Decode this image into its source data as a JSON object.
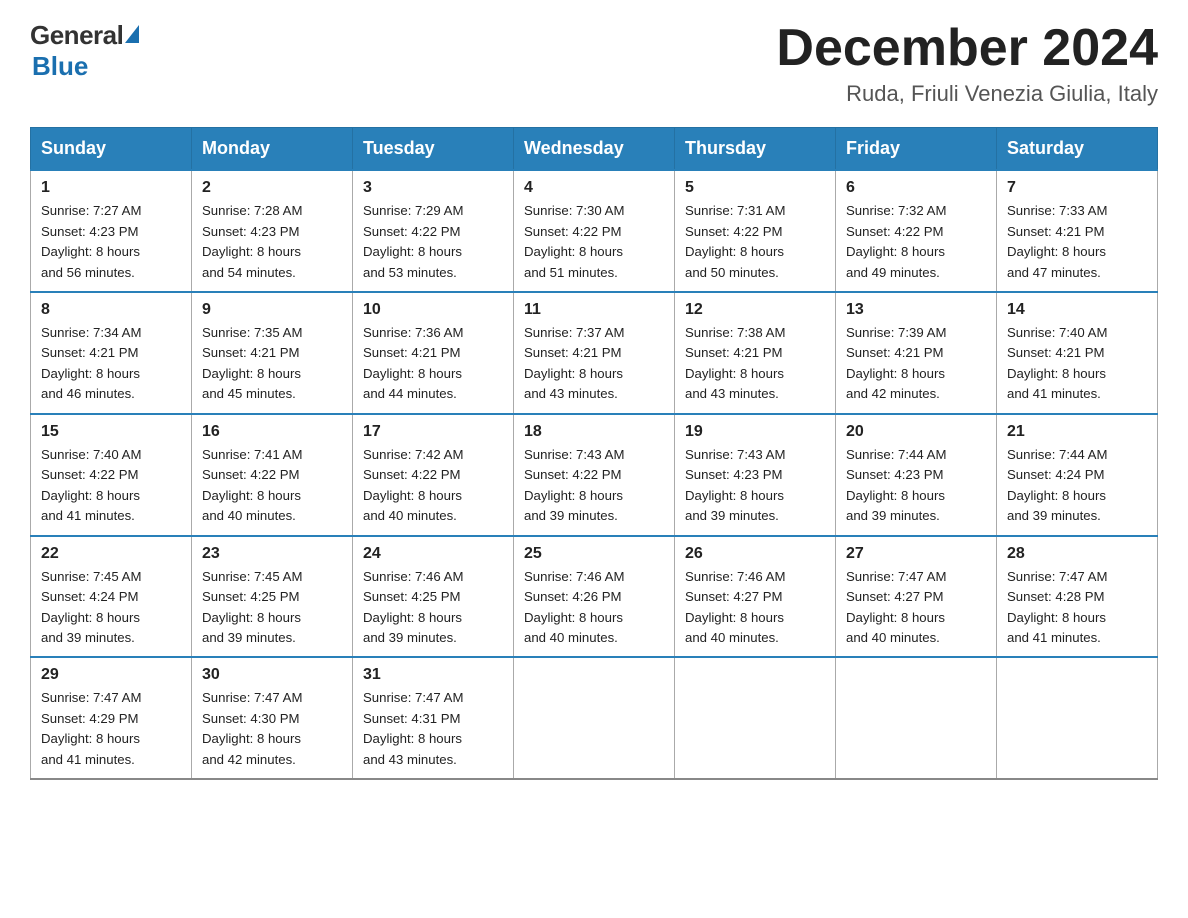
{
  "header": {
    "logo_general": "General",
    "logo_blue": "Blue",
    "month_year": "December 2024",
    "location": "Ruda, Friuli Venezia Giulia, Italy"
  },
  "days_of_week": [
    "Sunday",
    "Monday",
    "Tuesday",
    "Wednesday",
    "Thursday",
    "Friday",
    "Saturday"
  ],
  "weeks": [
    [
      {
        "day": "1",
        "sunrise": "7:27 AM",
        "sunset": "4:23 PM",
        "daylight": "8 hours and 56 minutes."
      },
      {
        "day": "2",
        "sunrise": "7:28 AM",
        "sunset": "4:23 PM",
        "daylight": "8 hours and 54 minutes."
      },
      {
        "day": "3",
        "sunrise": "7:29 AM",
        "sunset": "4:22 PM",
        "daylight": "8 hours and 53 minutes."
      },
      {
        "day": "4",
        "sunrise": "7:30 AM",
        "sunset": "4:22 PM",
        "daylight": "8 hours and 51 minutes."
      },
      {
        "day": "5",
        "sunrise": "7:31 AM",
        "sunset": "4:22 PM",
        "daylight": "8 hours and 50 minutes."
      },
      {
        "day": "6",
        "sunrise": "7:32 AM",
        "sunset": "4:22 PM",
        "daylight": "8 hours and 49 minutes."
      },
      {
        "day": "7",
        "sunrise": "7:33 AM",
        "sunset": "4:21 PM",
        "daylight": "8 hours and 47 minutes."
      }
    ],
    [
      {
        "day": "8",
        "sunrise": "7:34 AM",
        "sunset": "4:21 PM",
        "daylight": "8 hours and 46 minutes."
      },
      {
        "day": "9",
        "sunrise": "7:35 AM",
        "sunset": "4:21 PM",
        "daylight": "8 hours and 45 minutes."
      },
      {
        "day": "10",
        "sunrise": "7:36 AM",
        "sunset": "4:21 PM",
        "daylight": "8 hours and 44 minutes."
      },
      {
        "day": "11",
        "sunrise": "7:37 AM",
        "sunset": "4:21 PM",
        "daylight": "8 hours and 43 minutes."
      },
      {
        "day": "12",
        "sunrise": "7:38 AM",
        "sunset": "4:21 PM",
        "daylight": "8 hours and 43 minutes."
      },
      {
        "day": "13",
        "sunrise": "7:39 AM",
        "sunset": "4:21 PM",
        "daylight": "8 hours and 42 minutes."
      },
      {
        "day": "14",
        "sunrise": "7:40 AM",
        "sunset": "4:21 PM",
        "daylight": "8 hours and 41 minutes."
      }
    ],
    [
      {
        "day": "15",
        "sunrise": "7:40 AM",
        "sunset": "4:22 PM",
        "daylight": "8 hours and 41 minutes."
      },
      {
        "day": "16",
        "sunrise": "7:41 AM",
        "sunset": "4:22 PM",
        "daylight": "8 hours and 40 minutes."
      },
      {
        "day": "17",
        "sunrise": "7:42 AM",
        "sunset": "4:22 PM",
        "daylight": "8 hours and 40 minutes."
      },
      {
        "day": "18",
        "sunrise": "7:43 AM",
        "sunset": "4:22 PM",
        "daylight": "8 hours and 39 minutes."
      },
      {
        "day": "19",
        "sunrise": "7:43 AM",
        "sunset": "4:23 PM",
        "daylight": "8 hours and 39 minutes."
      },
      {
        "day": "20",
        "sunrise": "7:44 AM",
        "sunset": "4:23 PM",
        "daylight": "8 hours and 39 minutes."
      },
      {
        "day": "21",
        "sunrise": "7:44 AM",
        "sunset": "4:24 PM",
        "daylight": "8 hours and 39 minutes."
      }
    ],
    [
      {
        "day": "22",
        "sunrise": "7:45 AM",
        "sunset": "4:24 PM",
        "daylight": "8 hours and 39 minutes."
      },
      {
        "day": "23",
        "sunrise": "7:45 AM",
        "sunset": "4:25 PM",
        "daylight": "8 hours and 39 minutes."
      },
      {
        "day": "24",
        "sunrise": "7:46 AM",
        "sunset": "4:25 PM",
        "daylight": "8 hours and 39 minutes."
      },
      {
        "day": "25",
        "sunrise": "7:46 AM",
        "sunset": "4:26 PM",
        "daylight": "8 hours and 40 minutes."
      },
      {
        "day": "26",
        "sunrise": "7:46 AM",
        "sunset": "4:27 PM",
        "daylight": "8 hours and 40 minutes."
      },
      {
        "day": "27",
        "sunrise": "7:47 AM",
        "sunset": "4:27 PM",
        "daylight": "8 hours and 40 minutes."
      },
      {
        "day": "28",
        "sunrise": "7:47 AM",
        "sunset": "4:28 PM",
        "daylight": "8 hours and 41 minutes."
      }
    ],
    [
      {
        "day": "29",
        "sunrise": "7:47 AM",
        "sunset": "4:29 PM",
        "daylight": "8 hours and 41 minutes."
      },
      {
        "day": "30",
        "sunrise": "7:47 AM",
        "sunset": "4:30 PM",
        "daylight": "8 hours and 42 minutes."
      },
      {
        "day": "31",
        "sunrise": "7:47 AM",
        "sunset": "4:31 PM",
        "daylight": "8 hours and 43 minutes."
      },
      null,
      null,
      null,
      null
    ]
  ],
  "labels": {
    "sunrise": "Sunrise:",
    "sunset": "Sunset:",
    "daylight": "Daylight:"
  }
}
